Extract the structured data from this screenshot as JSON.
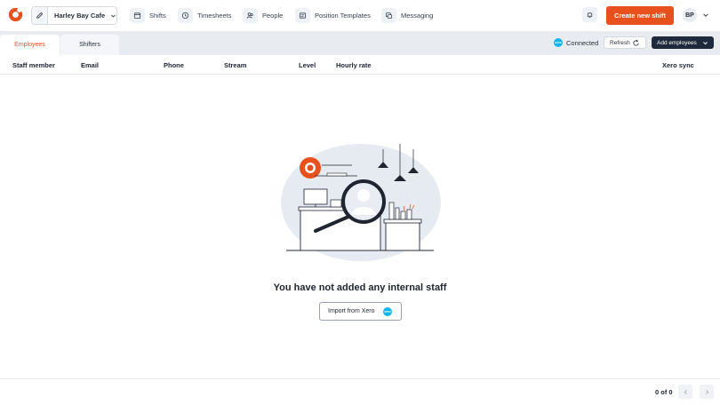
{
  "header": {
    "venue_name": "Harley Bay Cafe",
    "nav": [
      {
        "label": "Shifts",
        "icon": "calendar-icon"
      },
      {
        "label": "Timesheets",
        "icon": "clock-icon"
      },
      {
        "label": "People",
        "icon": "people-icon"
      },
      {
        "label": "Position Templates",
        "icon": "template-icon"
      },
      {
        "label": "Messaging",
        "icon": "message-icon"
      }
    ],
    "create_button": "Create new shift",
    "avatar_initials": "BP"
  },
  "tabs": [
    {
      "label": "Employees",
      "active": true
    },
    {
      "label": "Shifters",
      "active": false
    }
  ],
  "toolbar": {
    "status": "Connected",
    "refresh": "Refresh",
    "add": "Add employees"
  },
  "table": {
    "columns": [
      "Staff member",
      "Email",
      "Phone",
      "Stream",
      "Level",
      "Hourly rate",
      "Xero sync"
    ]
  },
  "empty_state": {
    "message": "You have not added any internal staff",
    "import_button": "Import from Xero",
    "xero_badge": "xero"
  },
  "pagination": {
    "text": "0 of 0"
  },
  "colors": {
    "accent": "#e8501e",
    "dark": "#1d2a3b",
    "xero": "#13b5ea",
    "tab_bg": "#e8ecf1"
  }
}
